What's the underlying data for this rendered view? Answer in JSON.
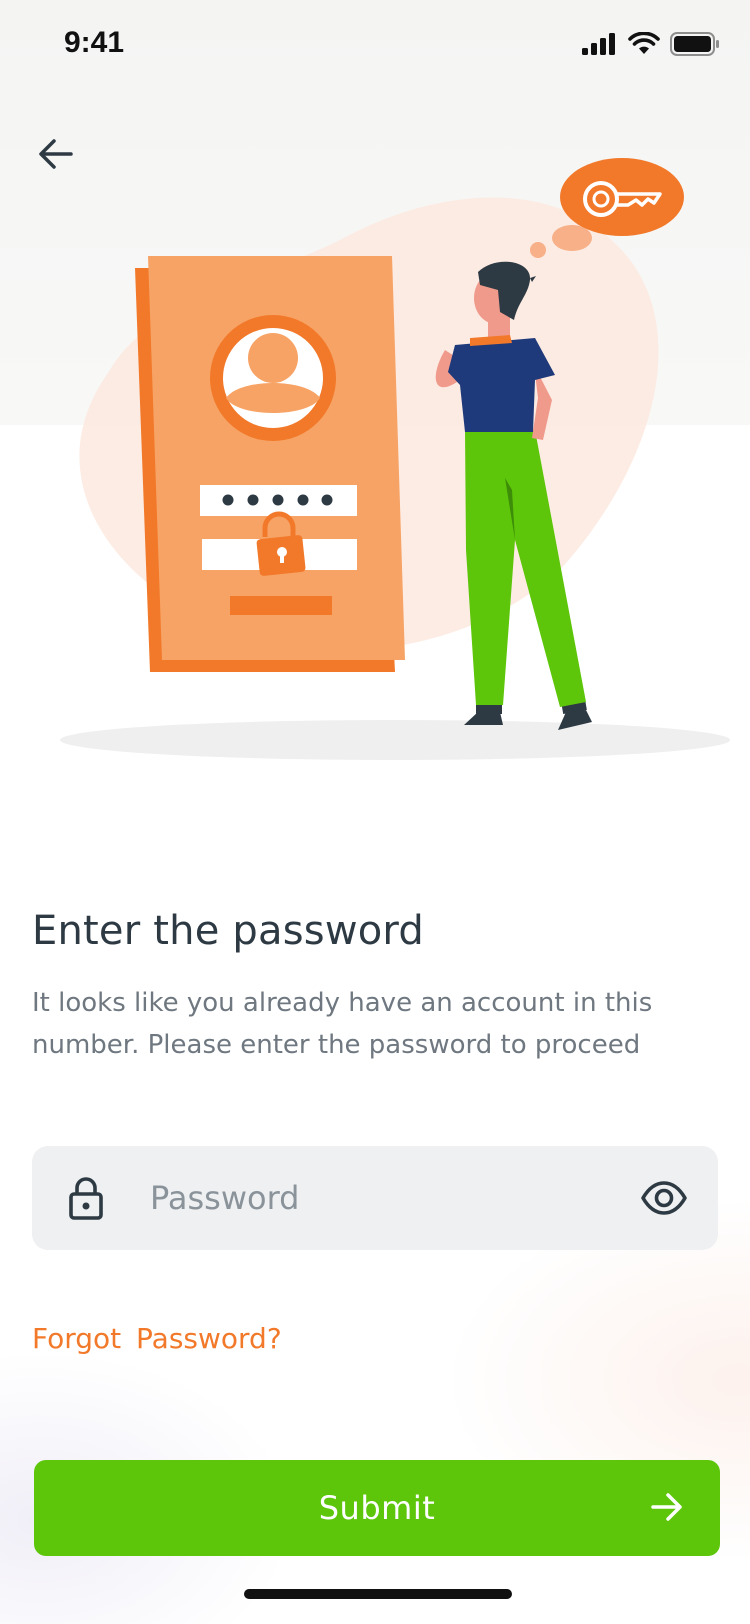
{
  "status_bar": {
    "time": "9:41",
    "icons": [
      "cellular-signal-icon",
      "wifi-icon",
      "battery-icon"
    ]
  },
  "nav": {
    "back_icon": "arrow-left-icon"
  },
  "illustration": {
    "description_icons": [
      "login-card-icon",
      "user-avatar-icon",
      "padlock-icon",
      "key-thought-bubble-icon",
      "thinking-person-icon"
    ],
    "password_mask": "• • • • •"
  },
  "content": {
    "title": "Enter the password",
    "subtitle": "It looks like you already have an account in this number. Please enter the password to proceed"
  },
  "password_field": {
    "placeholder": "Password",
    "value": "",
    "leading_icon": "lock-icon",
    "trailing_icon": "eye-icon"
  },
  "forgot_password": {
    "label": "Forgot  Password?"
  },
  "submit": {
    "label": "Submit",
    "icon": "arrow-right-icon"
  },
  "colors": {
    "accent_orange": "#f2792a",
    "primary_green": "#5dc60a",
    "text_dark": "#2e3a43",
    "text_muted": "#6f7880",
    "field_bg": "#eff0f2"
  }
}
